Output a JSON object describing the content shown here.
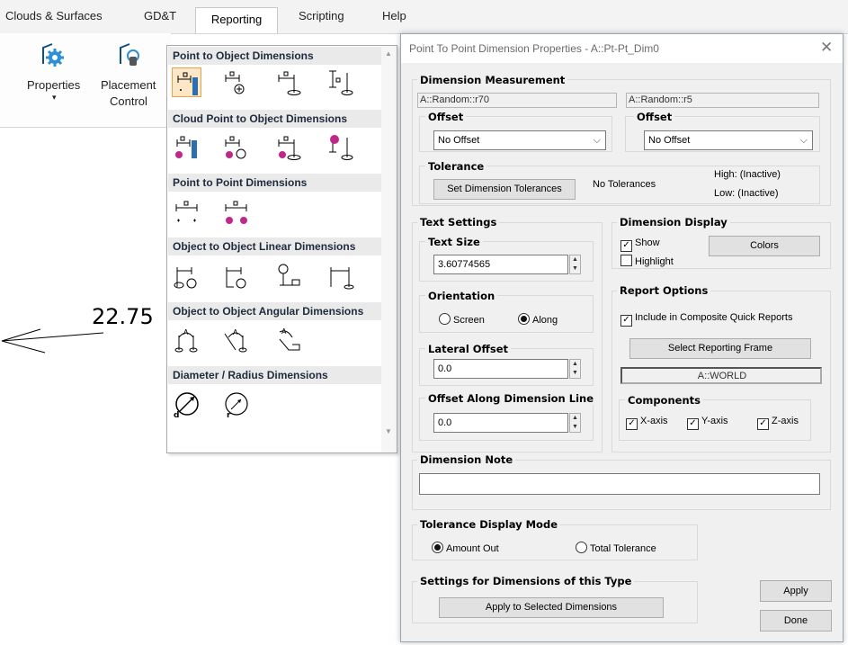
{
  "ribbon": {
    "tabs": [
      "Clouds & Surfaces",
      "GD&T",
      "Reporting",
      "Scripting",
      "Help"
    ],
    "active_tab": "Reporting",
    "properties_label": "Properties",
    "placement_label_1": "Placement",
    "placement_label_2": "Control"
  },
  "canvas": {
    "dimension_value": "22.75"
  },
  "dropdown": {
    "sections": [
      "Point to Object Dimensions",
      "Cloud Point to Object Dimensions",
      "Point to Point Dimensions",
      "Object to Object Linear Dimensions",
      "Object to Object Angular Dimensions",
      "Diameter / Radius Dimensions"
    ]
  },
  "dialog": {
    "title": "Point To Point Dimension Properties - A::Pt-Pt_Dim0",
    "dimension_measurement": {
      "label": "Dimension Measurement",
      "point1": "A::Random::r70",
      "point2": "A::Random::r5",
      "offset_label": "Offset",
      "offset1": "No Offset",
      "offset2": "No Offset"
    },
    "tolerance": {
      "label": "Tolerance",
      "button": "Set Dimension Tolerances",
      "status": "No Tolerances",
      "high": "High: (Inactive)",
      "low": "Low: (Inactive)"
    },
    "text_settings": {
      "label": "Text Settings",
      "text_size_label": "Text Size",
      "text_size": "3.60774565",
      "orientation_label": "Orientation",
      "orient_screen": "Screen",
      "orient_along": "Along",
      "orientation_selected": "Along",
      "lateral_offset_label": "Lateral Offset",
      "lateral_offset": "0.0",
      "offset_along_label": "Offset Along Dimension Line",
      "offset_along": "0.0"
    },
    "dimension_display": {
      "label": "Dimension Display",
      "show": "Show",
      "show_checked": true,
      "highlight": "Highlight",
      "highlight_checked": false,
      "colors_button": "Colors"
    },
    "report_options": {
      "label": "Report Options",
      "include": "Include in Composite Quick Reports",
      "include_checked": true,
      "frame_button": "Select Reporting Frame",
      "frame_value": "A::WORLD",
      "components_label": "Components",
      "x_axis": "X-axis",
      "y_axis": "Y-axis",
      "z_axis": "Z-axis"
    },
    "dimension_note": {
      "label": "Dimension Note",
      "value": ""
    },
    "tolerance_display": {
      "label": "Tolerance Display Mode",
      "amount_out": "Amount Out",
      "total_tolerance": "Total Tolerance",
      "selected": "Amount Out"
    },
    "settings_type": {
      "label": "Settings for Dimensions of this Type",
      "apply_selected": "Apply to Selected Dimensions"
    },
    "apply_button": "Apply",
    "done_button": "Done"
  }
}
